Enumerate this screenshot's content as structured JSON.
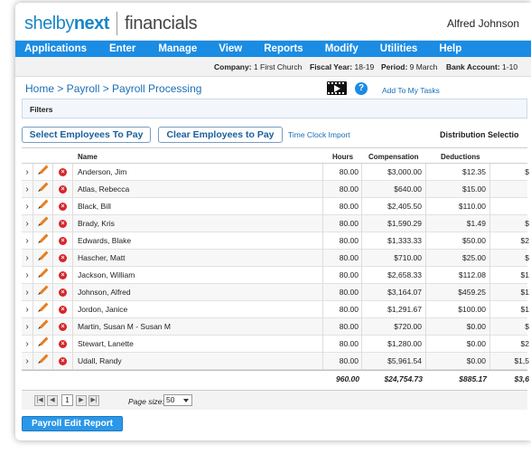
{
  "header": {
    "logo_brand_a": "shelby",
    "logo_brand_b": "next",
    "logo_product": "financials",
    "user_name": "Alfred Johnson"
  },
  "menu": [
    "Applications",
    "Enter",
    "Manage",
    "View",
    "Reports",
    "Modify",
    "Utilities",
    "Help"
  ],
  "info": {
    "company_label": "Company:",
    "company_value": "1 First Church",
    "fy_label": "Fiscal Year:",
    "fy_value": "18-19",
    "period_label": "Period:",
    "period_value": "9 March",
    "bank_label": "Bank Account:",
    "bank_value": "1-10"
  },
  "breadcrumb": "Home > Payroll > Payroll Processing",
  "add_to_tasks": "Add To My Tasks",
  "help_glyph": "?",
  "filters_label": "Filters",
  "buttons": {
    "select": "Select Employees To Pay",
    "clear": "Clear Employees to Pay",
    "time_clock": "Time Clock Import",
    "dist": "Distribution Selectio",
    "report": "Payroll Edit Report"
  },
  "columns": {
    "name": "Name",
    "hours": "Hours",
    "compensation": "Compensation",
    "deductions": "Deductions"
  },
  "rows": [
    {
      "name": "Anderson, Jim",
      "hours": "80.00",
      "comp": "$3,000.00",
      "ded": "$12.35",
      "next": "$"
    },
    {
      "name": "Atlas, Rebecca",
      "hours": "80.00",
      "comp": "$640.00",
      "ded": "$15.00",
      "next": ""
    },
    {
      "name": "Black, Bill",
      "hours": "80.00",
      "comp": "$2,405.50",
      "ded": "$110.00",
      "next": ""
    },
    {
      "name": "Brady, Kris",
      "hours": "80.00",
      "comp": "$1,590.29",
      "ded": "$1.49",
      "next": "$"
    },
    {
      "name": "Edwards, Blake",
      "hours": "80.00",
      "comp": "$1,333.33",
      "ded": "$50.00",
      "next": "$2"
    },
    {
      "name": "Hascher, Matt",
      "hours": "80.00",
      "comp": "$710.00",
      "ded": "$25.00",
      "next": "$"
    },
    {
      "name": "Jackson, William",
      "hours": "80.00",
      "comp": "$2,658.33",
      "ded": "$112.08",
      "next": "$1"
    },
    {
      "name": "Johnson, Alfred",
      "hours": "80.00",
      "comp": "$3,164.07",
      "ded": "$459.25",
      "next": "$1"
    },
    {
      "name": "Jordon, Janice",
      "hours": "80.00",
      "comp": "$1,291.67",
      "ded": "$100.00",
      "next": "$1"
    },
    {
      "name": "Martin, Susan M - Susan M",
      "hours": "80.00",
      "comp": "$720.00",
      "ded": "$0.00",
      "next": "$"
    },
    {
      "name": "Stewart, Lanette",
      "hours": "80.00",
      "comp": "$1,280.00",
      "ded": "$0.00",
      "next": "$2"
    },
    {
      "name": "Udall, Randy",
      "hours": "80.00",
      "comp": "$5,961.54",
      "ded": "$0.00",
      "next": "$1,5"
    }
  ],
  "totals": {
    "hours": "960.00",
    "comp": "$24,754.73",
    "ded": "$885.17",
    "next": "$3,6"
  },
  "pager": {
    "page": "1",
    "page_size_label": "Page size:",
    "page_size": "50"
  },
  "colors": {
    "accent": "#1a8ce3",
    "brand": "#1a86c8",
    "delete": "#d6262b",
    "edit": "#e87d1e"
  }
}
